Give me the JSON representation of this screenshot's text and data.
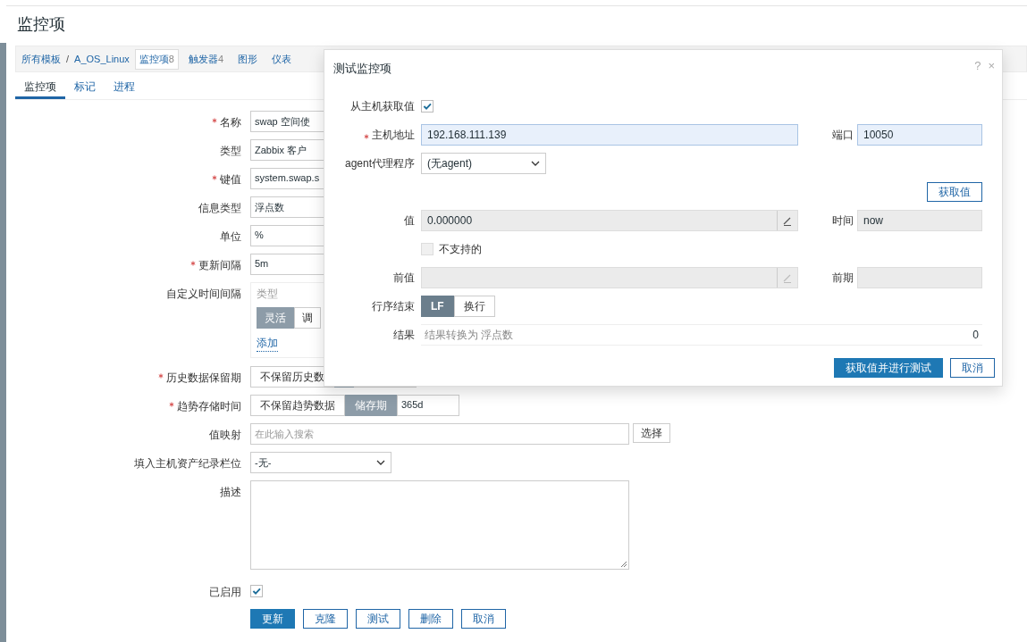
{
  "page_title": "监控项",
  "breadcrumb": {
    "path": [
      "所有模板",
      "A_OS_Linux"
    ],
    "separator": "/",
    "items": [
      {
        "label": "监控项",
        "count": "8",
        "selected": true
      },
      {
        "label": "触发器",
        "count": "4",
        "selected": false
      },
      {
        "label": "图形",
        "selected": false
      },
      {
        "label": "仪表",
        "selected": false
      }
    ]
  },
  "tabs": [
    {
      "label": "监控项",
      "selected": true
    },
    {
      "label": "标记",
      "selected": false
    },
    {
      "label": "进程",
      "selected": false
    }
  ],
  "form": {
    "rows": [
      {
        "kind": "text",
        "label": "名称",
        "required": true,
        "value": "swap 空间使"
      },
      {
        "kind": "text",
        "label": "类型",
        "required": false,
        "value": "Zabbix 客户"
      },
      {
        "kind": "text",
        "label": "键值",
        "required": true,
        "value": "system.swap.s"
      },
      {
        "kind": "text",
        "label": "信息类型",
        "required": false,
        "value": "浮点数"
      },
      {
        "kind": "text",
        "label": "单位",
        "required": false,
        "value": "%"
      },
      {
        "kind": "text",
        "label": "更新间隔",
        "required": true,
        "value": "5m"
      },
      {
        "kind": "intervals",
        "label": "自定义时间间隔",
        "required": false,
        "column": "类型",
        "options": [
          {
            "label": "灵活",
            "selected": true
          },
          {
            "label": "调",
            "selected": false
          }
        ],
        "link": "添加"
      },
      {
        "kind": "segmented",
        "label": "历史数据保留期",
        "required": true,
        "options": [
          {
            "label": "不保留历史数",
            "selected": false
          },
          {
            "selected": true
          }
        ]
      },
      {
        "kind": "segmented",
        "label": "趋势存储时间",
        "required": true,
        "options": [
          {
            "label": "不保留趋势数据",
            "selected": false
          },
          {
            "label": "储存期",
            "selected": true
          }
        ],
        "value": "365d"
      },
      {
        "kind": "search",
        "label": "值映射",
        "required": false,
        "placeholder": "在此输入搜索",
        "button": "选择"
      },
      {
        "kind": "select",
        "label": "填入主机资产纪录栏位",
        "required": false,
        "value": "-无-"
      },
      {
        "kind": "textarea",
        "label": "描述",
        "required": false
      },
      {
        "kind": "checkbox",
        "label": "已启用",
        "required": false,
        "checked": true
      }
    ],
    "buttons": [
      {
        "label": "更新",
        "primary": true
      },
      {
        "label": "克隆",
        "primary": false
      },
      {
        "label": "测试",
        "primary": false
      },
      {
        "label": "删除",
        "primary": false
      },
      {
        "label": "取消",
        "primary": false
      }
    ]
  },
  "modal": {
    "title": "测试监控项",
    "help": "?",
    "close": "×",
    "get_from_host": {
      "label": "从主机获取值",
      "checked": true
    },
    "host": {
      "label": "主机地址",
      "required": true,
      "value": "192.168.111.139"
    },
    "port": {
      "label": "端口",
      "value": "10050"
    },
    "proxy": {
      "label": "agent代理程序",
      "value": "(无agent)"
    },
    "get_button": "获取值",
    "value": {
      "label": "值",
      "value": "0.000000"
    },
    "time": {
      "label": "时间",
      "value": "now"
    },
    "unsupported": {
      "label": "不支持的",
      "checked": false
    },
    "prev_value": {
      "label": "前值"
    },
    "prev_time": {
      "label": "前期"
    },
    "eol": {
      "label": "行序结束",
      "options": [
        {
          "label": "LF",
          "selected": true
        },
        {
          "label": "换行",
          "selected": false
        }
      ]
    },
    "result": {
      "label": "结果",
      "text": "结果转换为 浮点数",
      "value": "0"
    },
    "buttons": [
      {
        "label": "获取值并进行测试",
        "primary": true
      },
      {
        "label": "取消",
        "primary": false
      }
    ]
  }
}
